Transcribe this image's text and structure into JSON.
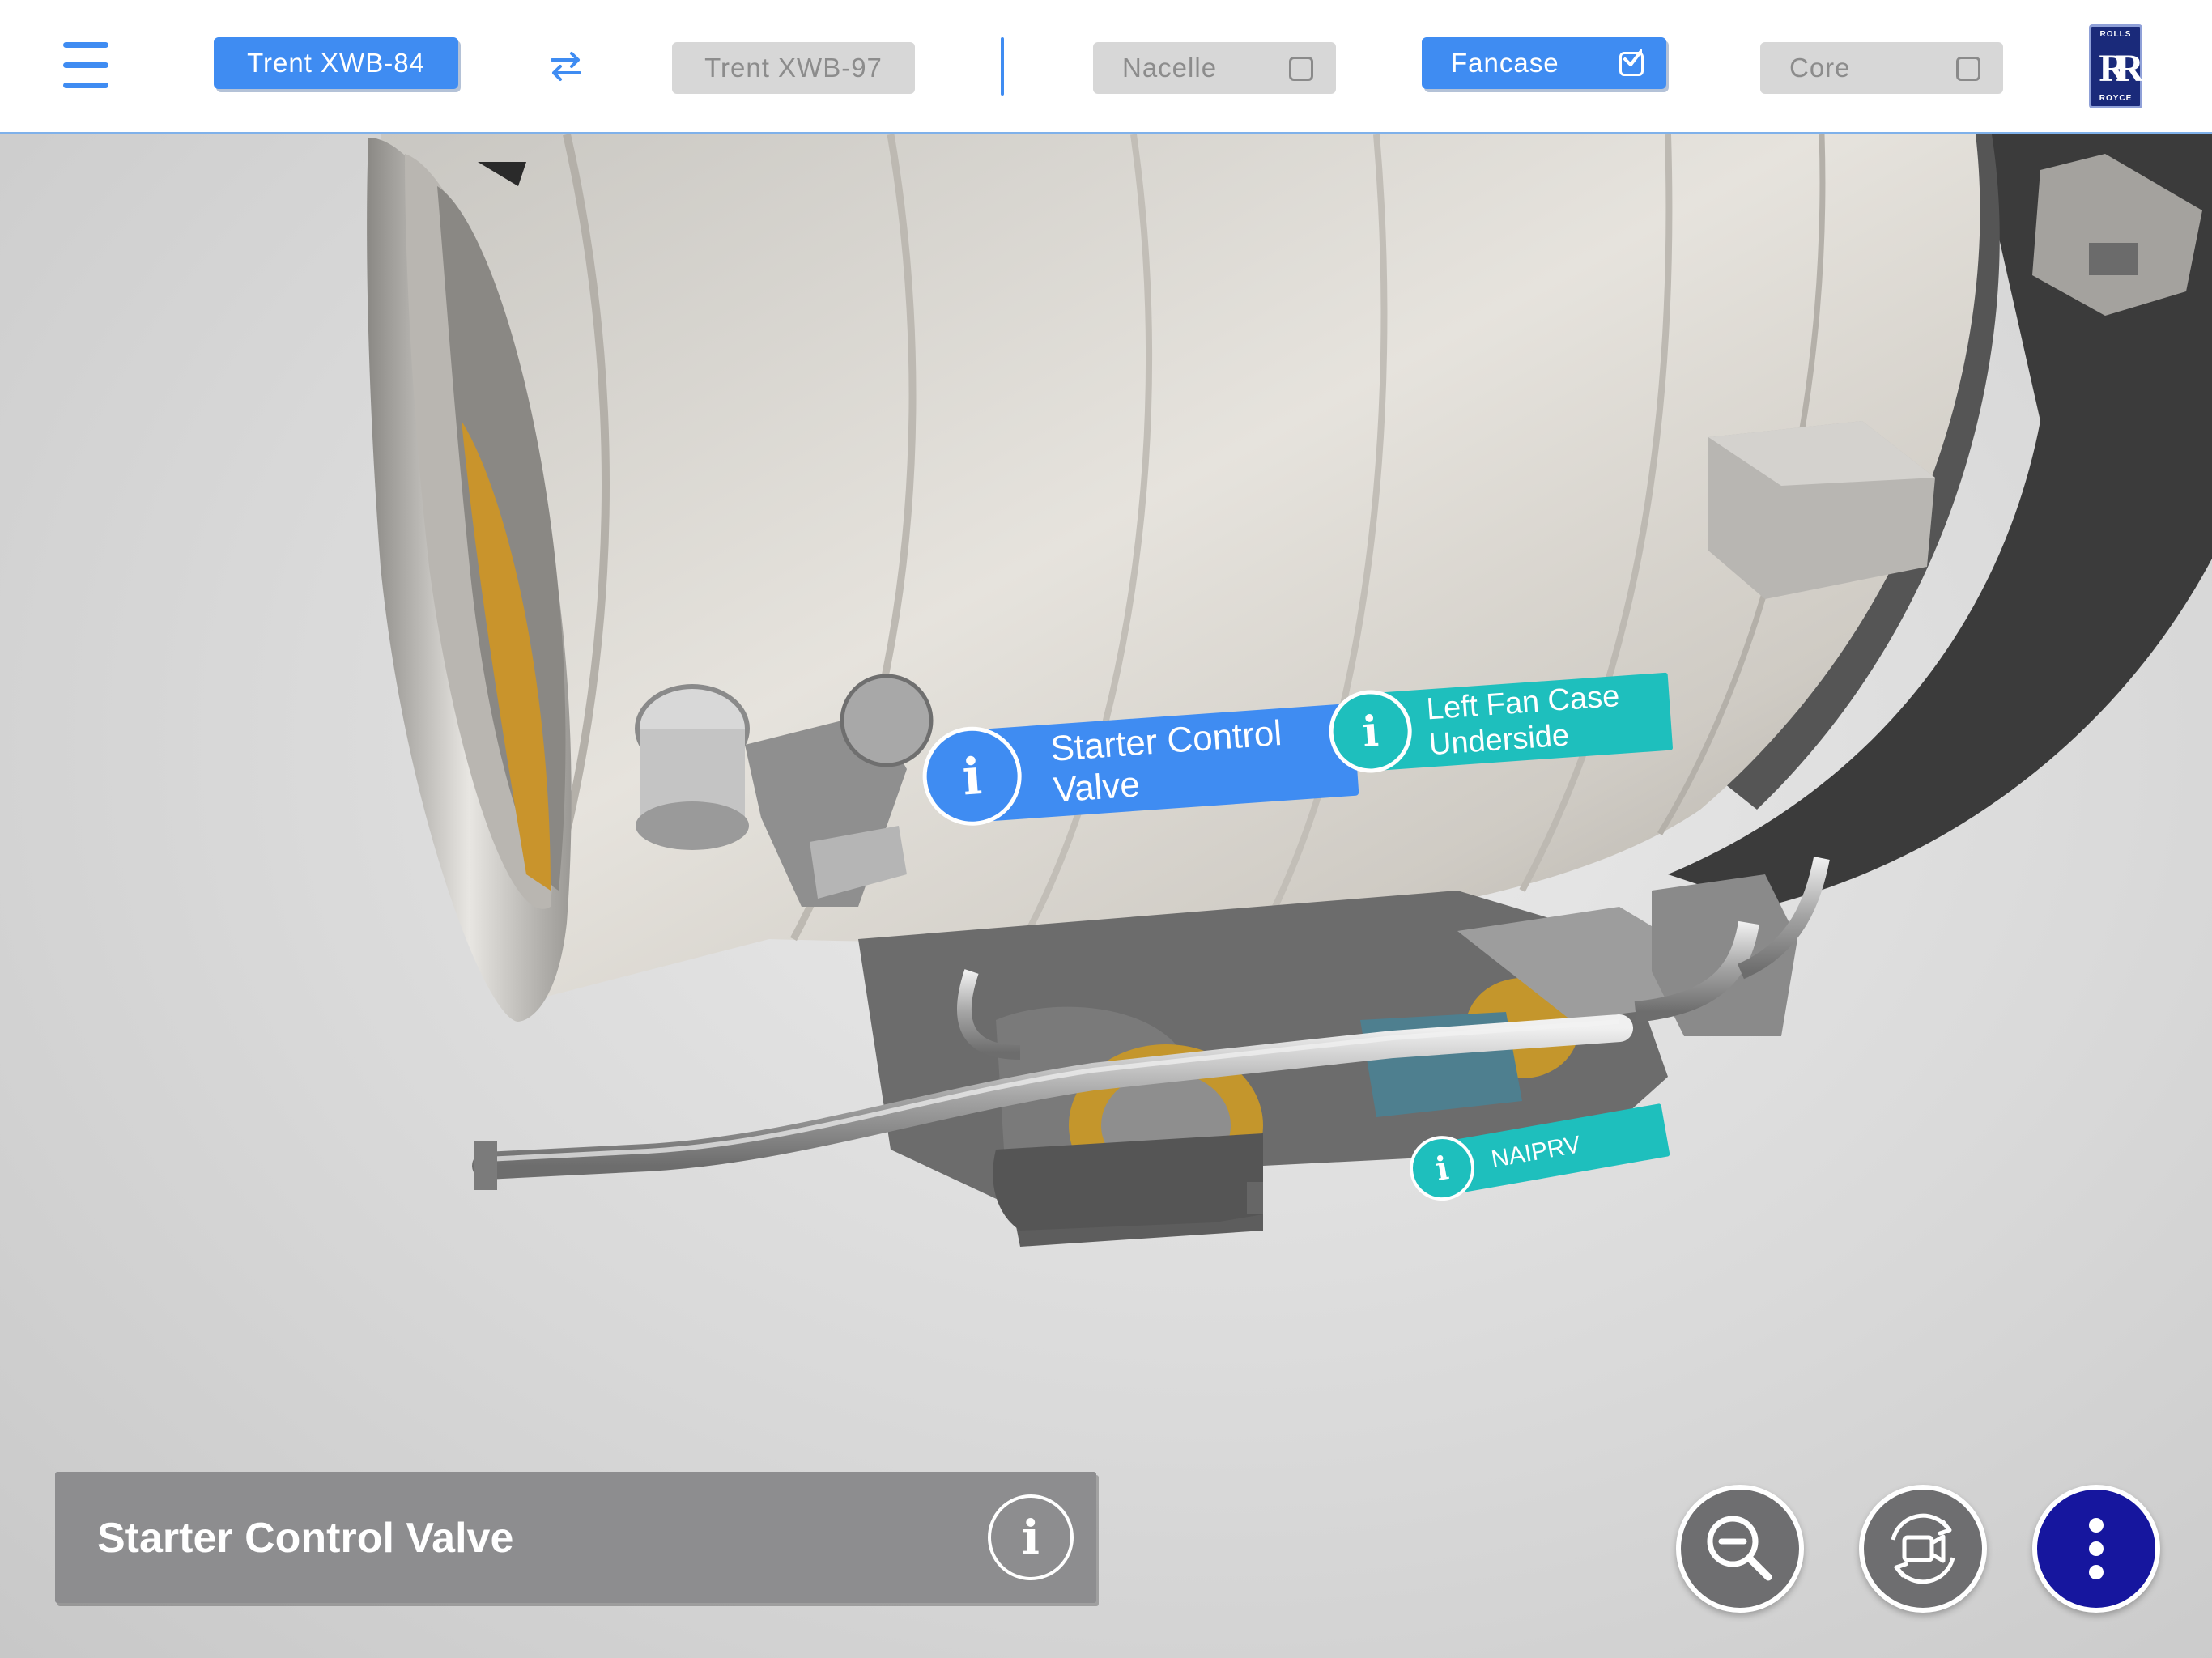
{
  "header": {
    "menu_icon": "hamburger-menu-icon",
    "engine_a": "Trent XWB-84",
    "swap_icon": "swap-arrows-icon",
    "engine_b": "Trent XWB-97",
    "filters": [
      {
        "label": "Nacelle",
        "checked": false
      },
      {
        "label": "Fancase",
        "checked": true
      },
      {
        "label": "Core",
        "checked": false
      }
    ],
    "logo": {
      "top": "ROLLS",
      "monogram": "RR",
      "bottom": "ROYCE"
    }
  },
  "hotspots": {
    "starter_control_valve": {
      "icon": "i",
      "label_line1": "Starter Control",
      "label_line2": "Valve",
      "selected": true
    },
    "left_fan_case_underside": {
      "icon": "i",
      "label_line1": "Left Fan Case",
      "label_line2": "Underside",
      "selected": false
    },
    "naiprv": {
      "icon": "i",
      "label": "NAIPRV",
      "selected": false
    }
  },
  "info_panel": {
    "title": "Starter Control Valve",
    "info_icon": "i"
  },
  "controls": {
    "zoom_out_icon": "zoom-out-icon",
    "camera_icon": "camera-rotate-icon",
    "more_icon": "more-vertical-icon"
  },
  "colors": {
    "accent_blue": "#3f8cf2",
    "teal": "#1ebfbd",
    "panel_gray": "#8d8d8f",
    "more_button_navy": "#16169e"
  }
}
